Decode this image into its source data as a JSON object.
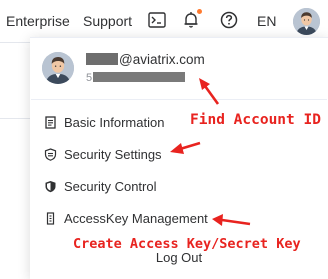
{
  "header": {
    "nav": [
      "Enterprise",
      "Support"
    ],
    "language": "EN",
    "icons": [
      "console-icon",
      "bell-icon",
      "help-icon",
      "avatar"
    ],
    "notification_dot_color": "#ff7a2f"
  },
  "profile": {
    "email_suffix": "@aviatrix.com",
    "account_id_prefix": "5"
  },
  "menu": {
    "items": [
      {
        "label": "Basic Information",
        "icon": "document-icon"
      },
      {
        "label": "Security Settings",
        "icon": "shield-settings-icon"
      },
      {
        "label": "Security Control",
        "icon": "shield-icon"
      },
      {
        "label": "AccessKey Management",
        "icon": "key-icon"
      }
    ],
    "logout": "Log Out"
  },
  "annotations": {
    "find_account_id": "Find Account ID",
    "create_key": "Create Access Key/Secret Key",
    "color": "#e8231f"
  }
}
